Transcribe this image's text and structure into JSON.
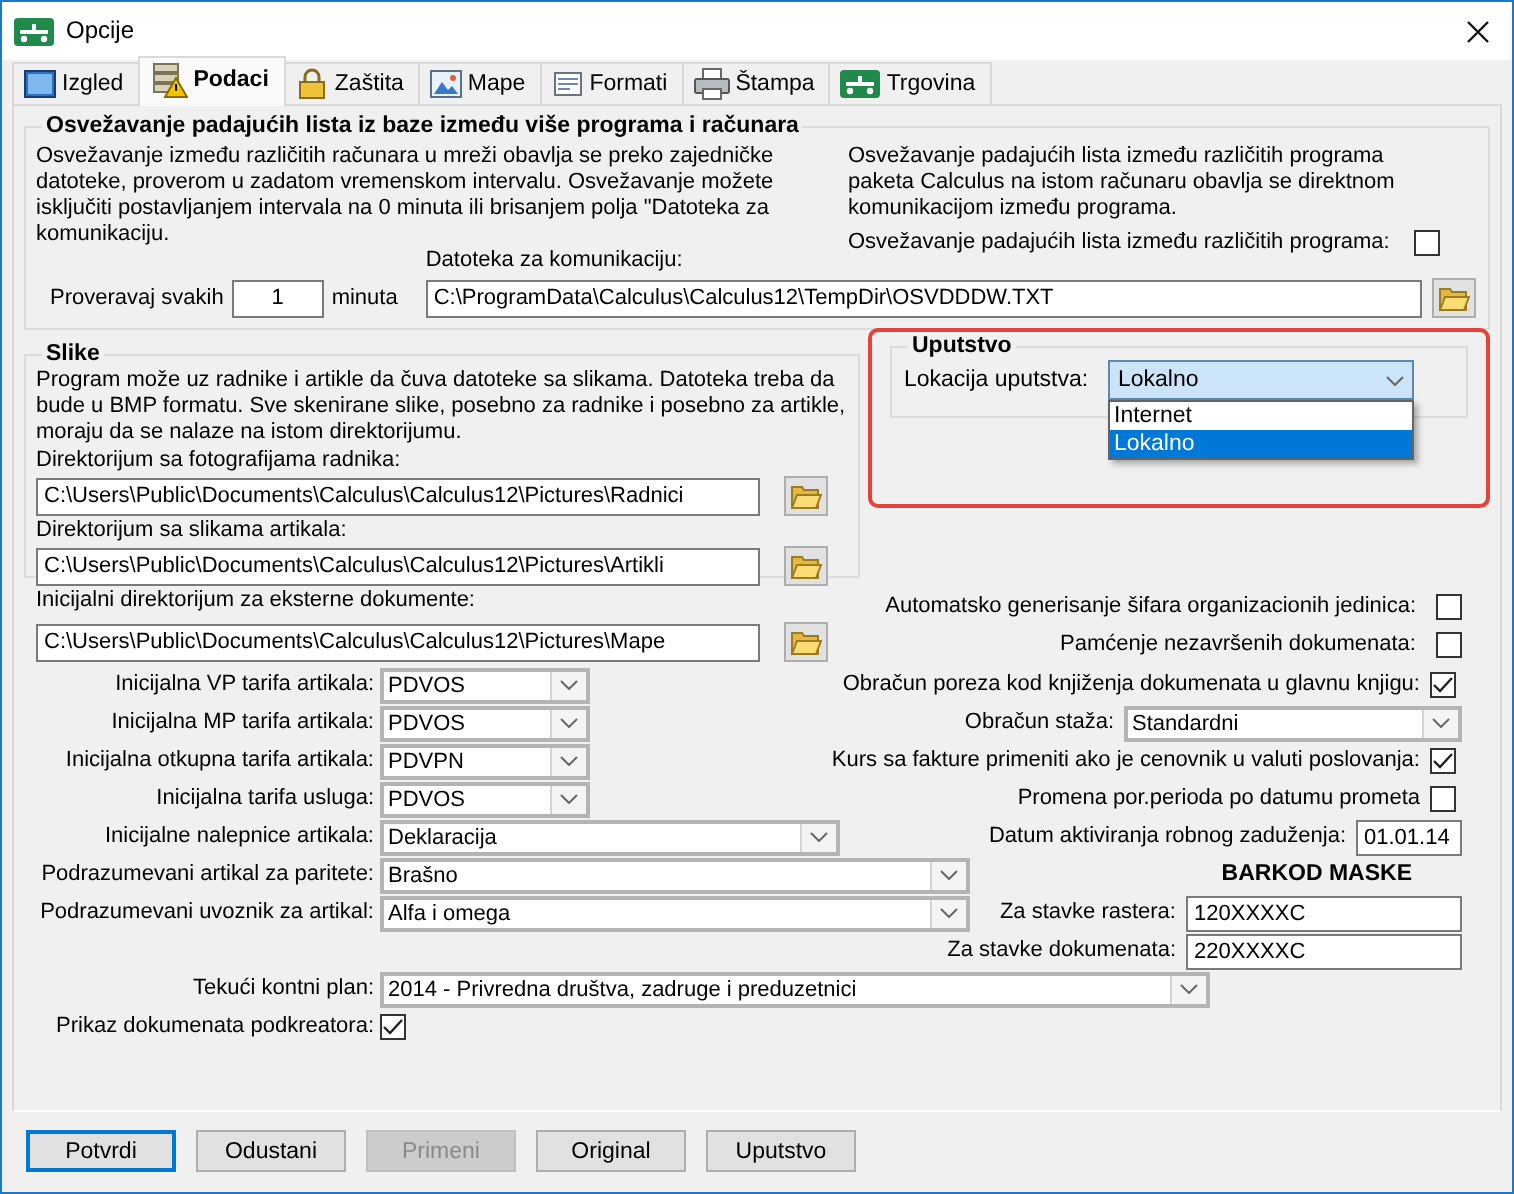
{
  "window": {
    "title": "Opcije"
  },
  "tabs": [
    {
      "label": "Izgled",
      "selected": false
    },
    {
      "label": "Podaci",
      "selected": true
    },
    {
      "label": "Zaštita",
      "selected": false
    },
    {
      "label": "Mape",
      "selected": false
    },
    {
      "label": "Formati",
      "selected": false
    },
    {
      "label": "Štampa",
      "selected": false
    },
    {
      "label": "Trgovina",
      "selected": false
    }
  ],
  "sync": {
    "title": "Osvežavanje padajućih lista iz baze između više programa i računara",
    "network_note": "Osvežavanje između različitih računara u mreži obavlja se preko zajedničke datoteke, proverom u zadatom vremenskom intervalu. Osvežavanje možete isključiti postavljanjem intervala na 0 minuta ili brisanjem polja \"Datoteka za komunikaciju.",
    "local_note": "Osvežavanje padajućih lista između različitih programa paketa Calculus na istom računaru obavlja se direktnom komunikacijom između programa.",
    "local_sync": {
      "label": "Osvežavanje padajućih lista između različitih programa:",
      "checked": false
    },
    "interval": {
      "label": "Proveravaj svakih",
      "value": "1",
      "unit": "minuta"
    },
    "file": {
      "label": "Datoteka za komunikaciju:",
      "value": "C:\\ProgramData\\Calculus\\Calculus12\\TempDir\\OSVDDDW.TXT"
    }
  },
  "images": {
    "title": "Slike",
    "note": "Program može uz radnike i artikle da čuva datoteke sa slikama. Datoteka treba da bude u BMP formatu. Sve skenirane slike, posebno za radnike i posebno za artikle, moraju da se nalaze na istom direktorijumu.",
    "folders": [
      {
        "label": "Direktorijum sa fotografijama radnika:",
        "value": "C:\\Users\\Public\\Documents\\Calculus\\Calculus12\\Pictures\\Radnici"
      },
      {
        "label": "Direktorijum sa slikama artikala:",
        "value": "C:\\Users\\Public\\Documents\\Calculus\\Calculus12\\Pictures\\Artikli"
      }
    ]
  },
  "manual": {
    "title": "Uputstvo",
    "highlighted": true,
    "label": "Lokacija uputstva:",
    "value": "Lokalno",
    "expanded": true,
    "options": [
      {
        "label": "Internet",
        "selected": false
      },
      {
        "label": "Lokalno",
        "selected": true
      }
    ]
  },
  "external_dir": {
    "label": "Inicijalni direktorijum za eksterne dokumente:",
    "value": "C:\\Users\\Public\\Documents\\Calculus\\Calculus12\\Pictures\\Mape"
  },
  "flags": [
    {
      "label": "Automatsko generisanje šifara organizacionih jedinica:",
      "checked": false
    },
    {
      "label": "Pamćenje nezavršenih dokumenata:",
      "checked": false
    }
  ],
  "settings_rows": [
    {
      "left": {
        "kind": "combo",
        "label": "Inicijalna VP tarifa artikala:",
        "value": "PDVOS"
      },
      "right": {
        "kind": "checkbox",
        "label": "Obračun poreza kod knjiženja dokumenata u glavnu knjigu:",
        "checked": true
      }
    },
    {
      "left": {
        "kind": "combo",
        "label": "Inicijalna MP tarifa artikala:",
        "value": "PDVOS"
      },
      "right": {
        "kind": "combo",
        "label": "Obračun staža:",
        "value": "Standardni"
      }
    },
    {
      "left": {
        "kind": "combo",
        "label": "Inicijalna otkupna tarifa artikala:",
        "value": "PDVPN"
      },
      "right": {
        "kind": "checkbox",
        "label": "Kurs sa fakture primeniti ako je cenovnik u valuti poslovanja:",
        "checked": true
      }
    },
    {
      "left": {
        "kind": "combo",
        "label": "Inicijalna tarifa usluga:",
        "value": "PDVOS"
      },
      "right": {
        "kind": "checkbox",
        "label": "Promena por.perioda po datumu prometa",
        "checked": false
      }
    },
    {
      "left": {
        "kind": "combo",
        "label": "Inicijalne nalepnice artikala:",
        "value": "Deklaracija"
      },
      "right": {
        "kind": "text",
        "label": "Datum aktiviranja robnog zaduženja:",
        "value": "01.01.14"
      }
    },
    {
      "left": {
        "kind": "combo",
        "label": "Podrazumevani artikal za paritete:",
        "value": "Brašno"
      },
      "right": {
        "kind": "heading",
        "label": "BARKOD MASKE"
      }
    },
    {
      "left": {
        "kind": "combo",
        "label": "Podrazumevani uvoznik za artikal:",
        "value": "Alfa i omega"
      },
      "right": {
        "kind": "text",
        "label": "Za stavke rastera:",
        "value": "120XXXXC"
      }
    },
    {
      "right": {
        "kind": "text",
        "label": "Za stavke dokumenata:",
        "value": "220XXXXC"
      }
    },
    {
      "left": {
        "kind": "combo",
        "label": "Tekući kontni plan:",
        "value": "2014 - Privredna društva, zadruge i preduzetnici"
      }
    },
    {
      "left": {
        "kind": "checkbox",
        "label": "Prikaz dokumenata podkreatora:",
        "checked": true
      }
    }
  ],
  "buttons": [
    {
      "label": "Potvrdi",
      "default": true,
      "disabled": false
    },
    {
      "label": "Odustani",
      "default": false,
      "disabled": false
    },
    {
      "label": "Primeni",
      "default": false,
      "disabled": true
    },
    {
      "label": "Original",
      "default": false,
      "disabled": false
    },
    {
      "label": "Uputstvo",
      "default": false,
      "disabled": false
    }
  ]
}
